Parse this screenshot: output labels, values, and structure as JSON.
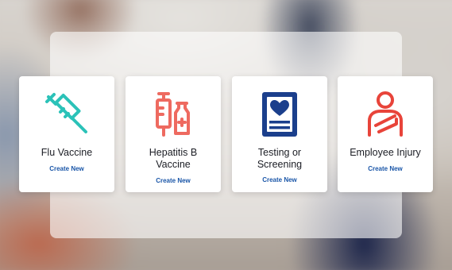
{
  "cards": [
    {
      "title": "Flu Vaccine",
      "action": "Create New",
      "icon": "syringe-icon",
      "icon_color": "#2bc2b8"
    },
    {
      "title": "Hepatitis B Vaccine",
      "action": "Create New",
      "icon": "vaccine-vial-icon",
      "icon_color": "#ee6a60"
    },
    {
      "title": "Testing or Screening",
      "action": "Create New",
      "icon": "health-record-icon",
      "icon_color": "#1b3f8c"
    },
    {
      "title": "Employee Injury",
      "action": "Create New",
      "icon": "injured-person-icon",
      "icon_color": "#e8443a"
    }
  ]
}
